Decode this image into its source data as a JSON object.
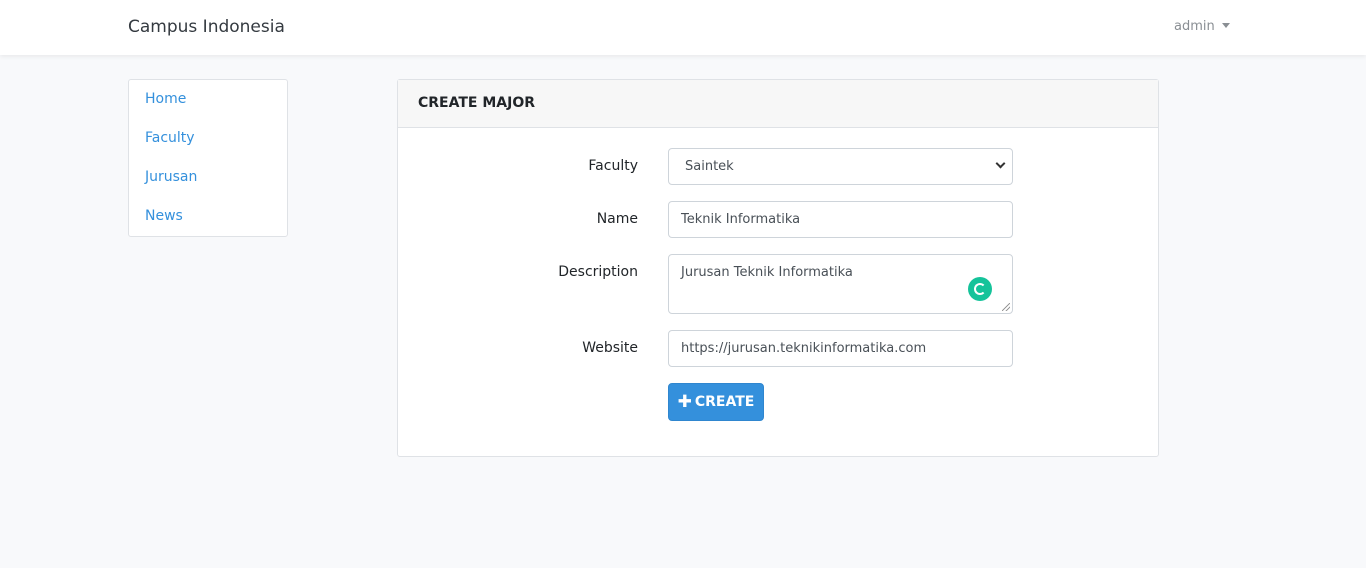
{
  "navbar": {
    "brand": "Campus Indonesia",
    "user": "admin"
  },
  "sidebar": {
    "items": [
      {
        "label": "Home"
      },
      {
        "label": "Faculty"
      },
      {
        "label": "Jurusan"
      },
      {
        "label": "News"
      }
    ]
  },
  "form": {
    "title": "CREATE MAJOR",
    "faculty_label": "Faculty",
    "faculty_value": "Saintek",
    "name_label": "Name",
    "name_value": "Teknik Informatika",
    "description_label": "Description",
    "description_value": "Jurusan Teknik Informatika",
    "website_label": "Website",
    "website_value": "https://jurusan.teknikinformatika.com",
    "submit_label": "CREATE",
    "submit_icon": "plus-icon"
  },
  "colors": {
    "accent": "#3490dc",
    "grammarly": "#15c39a"
  }
}
